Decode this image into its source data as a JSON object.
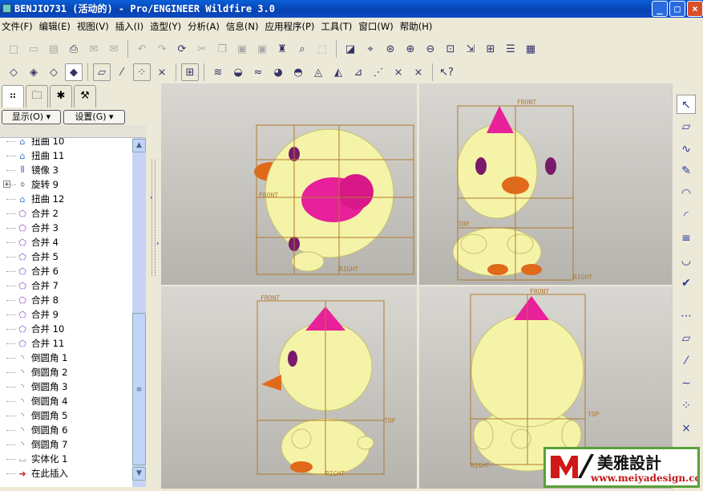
{
  "window": {
    "title": "BENJIO731 (活动的) - Pro/ENGINEER Wildfire 3.0",
    "minimize": "_",
    "maximize": "□",
    "close": "×"
  },
  "menu": [
    "文件(F)",
    "编辑(E)",
    "视图(V)",
    "插入(I)",
    "造型(Y)",
    "分析(A)",
    "信息(N)",
    "应用程序(P)",
    "工具(T)",
    "窗口(W)",
    "帮助(H)"
  ],
  "panel": {
    "show_button": "显示(O) ▾",
    "settings_button": "设置(G) ▾"
  },
  "tree": [
    {
      "icon": "warp-icon",
      "label": "扭曲 10"
    },
    {
      "icon": "warp-icon",
      "label": "扭曲 11"
    },
    {
      "icon": "mirror-icon",
      "label": "镜像 3"
    },
    {
      "icon": "revolve-icon",
      "label": "旋转 9",
      "expand": "+"
    },
    {
      "icon": "warp-icon",
      "label": "扭曲 12"
    },
    {
      "icon": "merge-icon",
      "label": "合并 2"
    },
    {
      "icon": "merge-icon",
      "label": "合并 3"
    },
    {
      "icon": "merge-icon",
      "label": "合并 4"
    },
    {
      "icon": "merge-icon",
      "label": "合并 5"
    },
    {
      "icon": "merge-icon",
      "label": "合并 6"
    },
    {
      "icon": "merge-icon",
      "label": "合并 7"
    },
    {
      "icon": "merge-icon",
      "label": "合并 8"
    },
    {
      "icon": "merge-icon",
      "label": "合并 9"
    },
    {
      "icon": "merge-icon",
      "label": "合并 10"
    },
    {
      "icon": "merge-icon",
      "label": "合并 11"
    },
    {
      "icon": "round-icon",
      "label": "倒圆角 1"
    },
    {
      "icon": "round-icon",
      "label": "倒圆角 2"
    },
    {
      "icon": "round-icon",
      "label": "倒圆角 3"
    },
    {
      "icon": "round-icon",
      "label": "倒圆角 4"
    },
    {
      "icon": "round-icon",
      "label": "倒圆角 5"
    },
    {
      "icon": "round-icon",
      "label": "倒圆角 6"
    },
    {
      "icon": "round-icon",
      "label": "倒圆角 7"
    },
    {
      "icon": "solidify-icon",
      "label": "实体化 1"
    },
    {
      "icon": "insert-here-icon",
      "label": "在此插入"
    }
  ],
  "viewports": [
    {
      "name": "top-left",
      "labels": [
        "FRONT",
        "RIGHT"
      ]
    },
    {
      "name": "top-right",
      "labels": [
        "FRONT",
        "TOP",
        "RIGHT"
      ]
    },
    {
      "name": "bottom-left",
      "labels": [
        "FRONT",
        "TOP",
        "RIGHT"
      ]
    },
    {
      "name": "bottom-right",
      "labels": [
        "FRONT",
        "TOP",
        "RIGHT"
      ]
    }
  ],
  "watermark": {
    "brand": "美雅設計",
    "url": "www.meiyadesign.com"
  },
  "colors": {
    "titlebar": "#0842b0",
    "body": "#f5f3a8",
    "beak": "#e06a1a",
    "crest": "#e8209a",
    "datum": "#b07a30"
  }
}
